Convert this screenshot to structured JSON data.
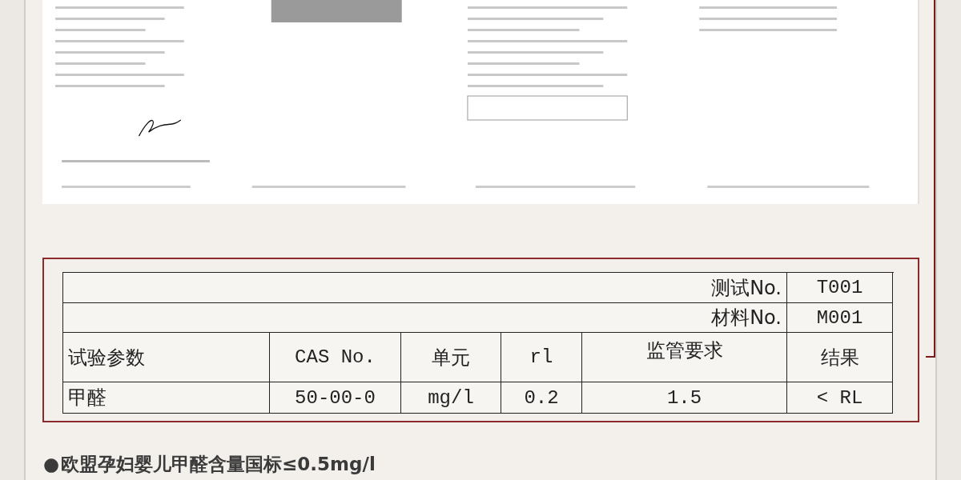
{
  "table": {
    "header_rows": [
      {
        "label": "测试No.",
        "value": "T001"
      },
      {
        "label": "材料No.",
        "value": "M001"
      }
    ],
    "columns": [
      "试验参数",
      "CAS No.",
      "单元",
      "rl",
      "监管要求",
      "结果"
    ],
    "rows": [
      [
        "甲醛",
        "50-00-0",
        "mg/l",
        "0.2",
        "1.5",
        "< RL"
      ]
    ]
  },
  "heading": {
    "bullet": "●",
    "text": "欧盟孕妇婴儿甲醛含量国标≤0.5mg/l"
  }
}
